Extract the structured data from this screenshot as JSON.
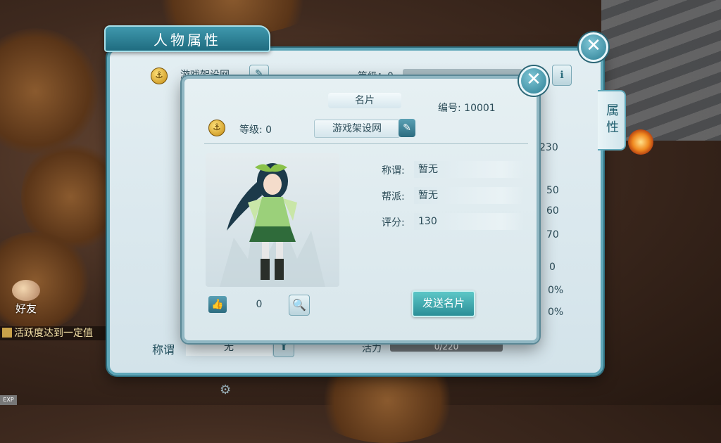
{
  "window": {
    "title": "人物属性",
    "side_tab": "属性",
    "bg_name": "游戏架设网",
    "bg_level_label": "等级：0",
    "stat_values": [
      "230",
      "50",
      "60",
      "70",
      "0",
      "0%",
      "0%"
    ],
    "title_label": "称谓",
    "title_value": "无",
    "vitality_label": "活力",
    "vitality_value": "0/220"
  },
  "card": {
    "title": "名片",
    "id_label": "编号:",
    "id_value": "10001",
    "level_label": "等级:",
    "level_value": "0",
    "player_name": "游戏架设网",
    "fields": [
      {
        "label": "称谓:",
        "value": "暂无"
      },
      {
        "label": "帮派:",
        "value": "暂无"
      },
      {
        "label": "评分:",
        "value": "130"
      }
    ],
    "likes": "0",
    "send_button": "发送名片"
  },
  "hud": {
    "friends_label": "好友",
    "chat_message": "活跃度达到一定值",
    "exp_label": "EXP"
  },
  "colors": {
    "frame": "#5fa7b9",
    "title_bar": "#1f6c80",
    "send_button": "#2b8f98",
    "bar_fill": "#6e7478"
  }
}
